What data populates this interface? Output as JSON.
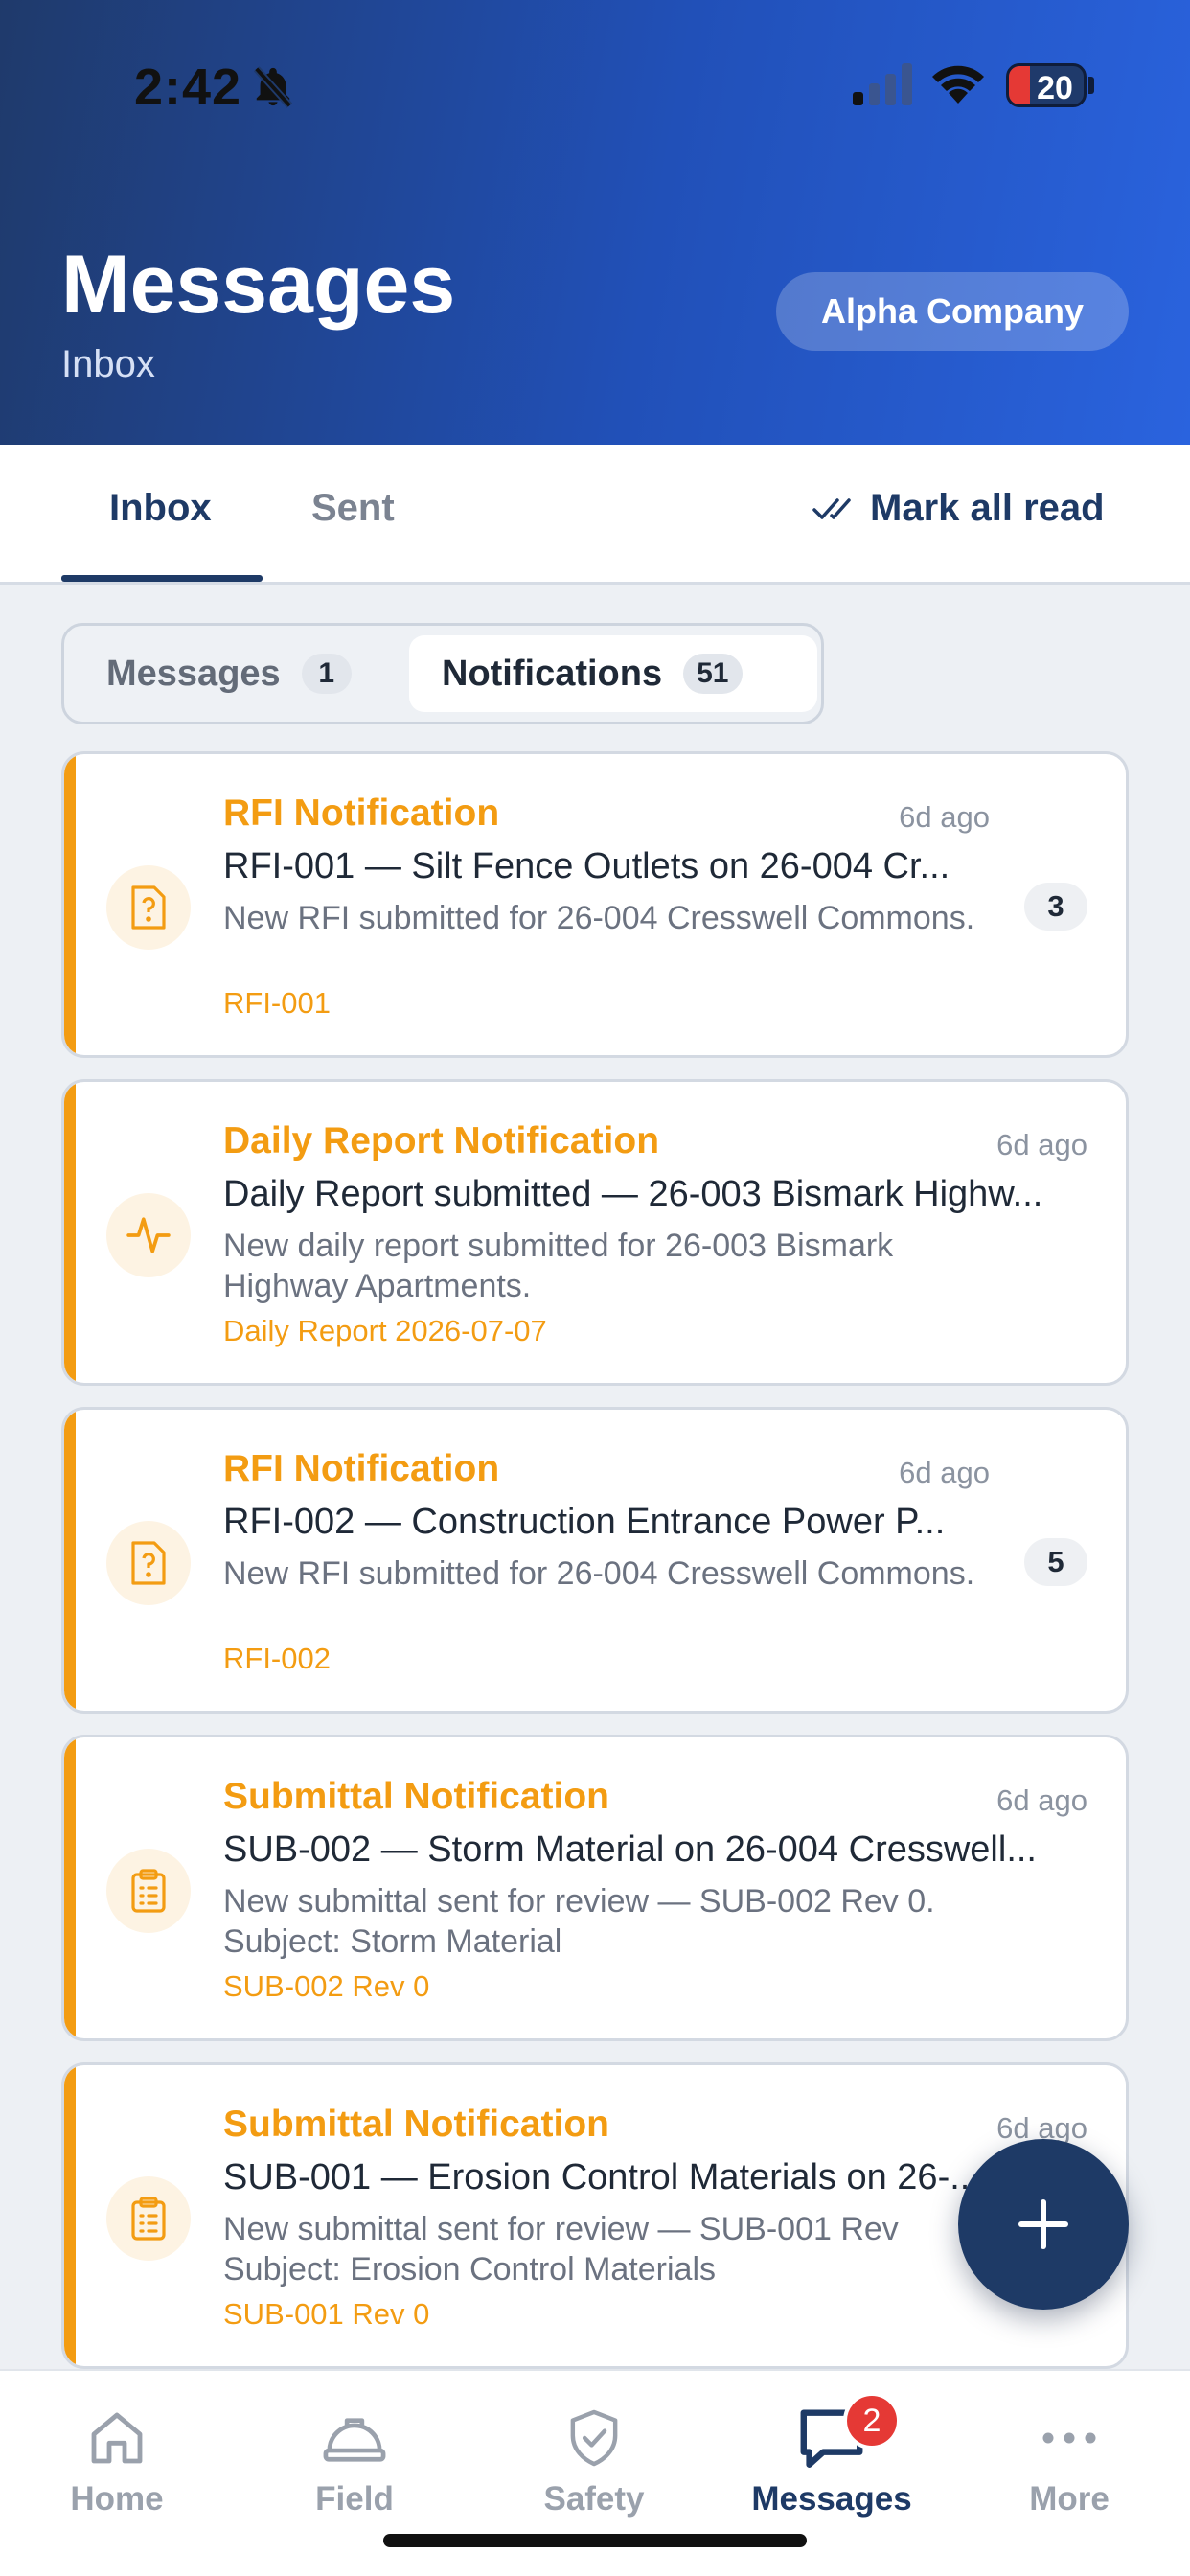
{
  "status": {
    "time": "2:42",
    "battery": "20"
  },
  "header": {
    "title": "Messages",
    "subtitle": "Inbox",
    "company": "Alpha Company"
  },
  "tabs": {
    "inbox": "Inbox",
    "sent": "Sent",
    "mark_all_read": "Mark all read"
  },
  "segments": {
    "messages_label": "Messages",
    "messages_count": "1",
    "notifications_label": "Notifications",
    "notifications_count": "51"
  },
  "notifications": [
    {
      "type": "RFI Notification",
      "time": "6d ago",
      "subject": "RFI-001 — Silt Fence Outlets on 26-004 Cr...",
      "body": "New RFI submitted for 26-004 Cresswell Commons.",
      "ref": "RFI-001",
      "count": "3",
      "icon": "question-doc-icon"
    },
    {
      "type": "Daily Report Notification",
      "time": "6d ago",
      "subject": "Daily Report submitted — 26-003 Bismark Highw...",
      "body": "New daily report submitted for 26-003 Bismark Highway Apartments.",
      "ref": "Daily Report 2026-07-07",
      "icon": "activity-icon"
    },
    {
      "type": "RFI Notification",
      "time": "6d ago",
      "subject": "RFI-002 — Construction Entrance Power P...",
      "body": "New RFI submitted for 26-004 Cresswell Commons.",
      "ref": "RFI-002",
      "count": "5",
      "icon": "question-doc-icon"
    },
    {
      "type": "Submittal Notification",
      "time": "6d ago",
      "subject": "SUB-002 — Storm Material on 26-004 Cresswell...",
      "body": "New submittal sent for review — SUB-002 Rev 0. Subject: Storm Material",
      "ref": "SUB-002 Rev 0",
      "icon": "clipboard-icon"
    },
    {
      "type": "Submittal Notification",
      "time": "6d ago",
      "subject": "SUB-001 — Erosion Control Materials on 26-...",
      "body": "New submittal sent for review — SUB-001 Rev Subject: Erosion Control Materials",
      "ref": "SUB-001 Rev 0",
      "icon": "clipboard-icon"
    }
  ],
  "nav": {
    "home": "Home",
    "field": "Field",
    "safety": "Safety",
    "messages": "Messages",
    "messages_badge": "2",
    "more": "More"
  },
  "colors": {
    "accent": "#f39c12",
    "primary": "#1e3a66",
    "badge": "#e53935"
  }
}
